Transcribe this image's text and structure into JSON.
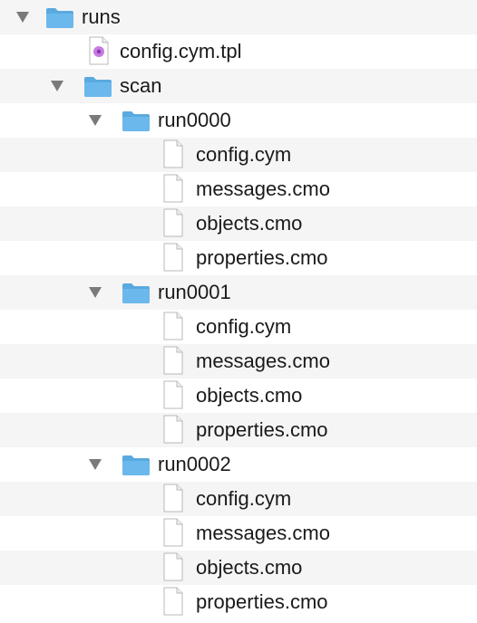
{
  "tree": {
    "runs": "runs",
    "config_tpl": "config.cym.tpl",
    "scan": "scan",
    "runs_list": [
      {
        "name": "run0000",
        "files": [
          "config.cym",
          "messages.cmo",
          "objects.cmo",
          "properties.cmo"
        ]
      },
      {
        "name": "run0001",
        "files": [
          "config.cym",
          "messages.cmo",
          "objects.cmo",
          "properties.cmo"
        ]
      },
      {
        "name": "run0002",
        "files": [
          "config.cym",
          "messages.cmo",
          "objects.cmo",
          "properties.cmo"
        ]
      }
    ]
  },
  "colors": {
    "folder": "#6bb8ec",
    "folder_tab": "#5aa9df",
    "disclosure": "#7a7a7a",
    "row_alt": "#f5f5f5"
  }
}
